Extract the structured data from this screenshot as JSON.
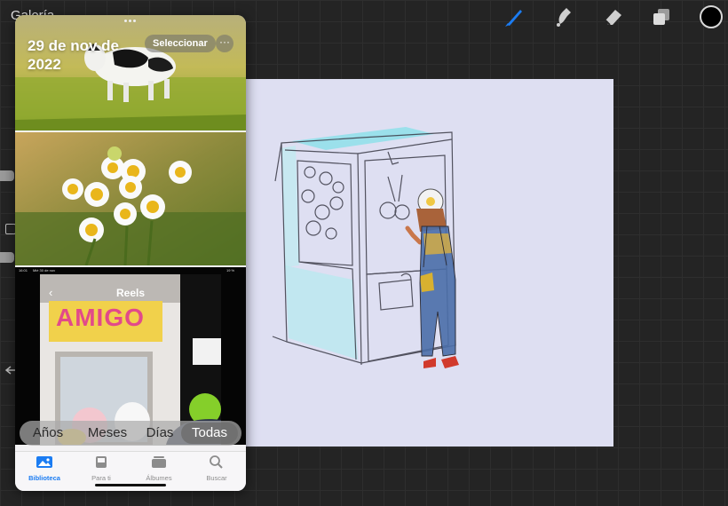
{
  "procreate": {
    "gallery_label": "Galería",
    "tools": {
      "brush": "brush-icon",
      "smudge": "smudge-icon",
      "eraser": "eraser-icon",
      "layers": "layers-icon",
      "color": "#000000"
    },
    "accent": "#1b7cf2"
  },
  "photos": {
    "date": "29 de nov de 2022",
    "select_label": "Seleccionar",
    "more_label": "···",
    "embedded_screenshot": {
      "status_time": "16:01",
      "status_date": "Mié 30 de nov",
      "battery": "19 %",
      "title": "Reels",
      "sign_text": "AMIGO"
    },
    "segments": [
      "Años",
      "Meses",
      "Días",
      "Todas"
    ],
    "active_segment": "Todas",
    "tabs": [
      {
        "label": "Biblioteca",
        "icon": "photos-library-icon",
        "active": true
      },
      {
        "label": "Para ti",
        "icon": "for-you-icon",
        "active": false
      },
      {
        "label": "Álbumes",
        "icon": "albums-icon",
        "active": false
      },
      {
        "label": "Buscar",
        "icon": "search-icon",
        "active": false
      }
    ]
  }
}
